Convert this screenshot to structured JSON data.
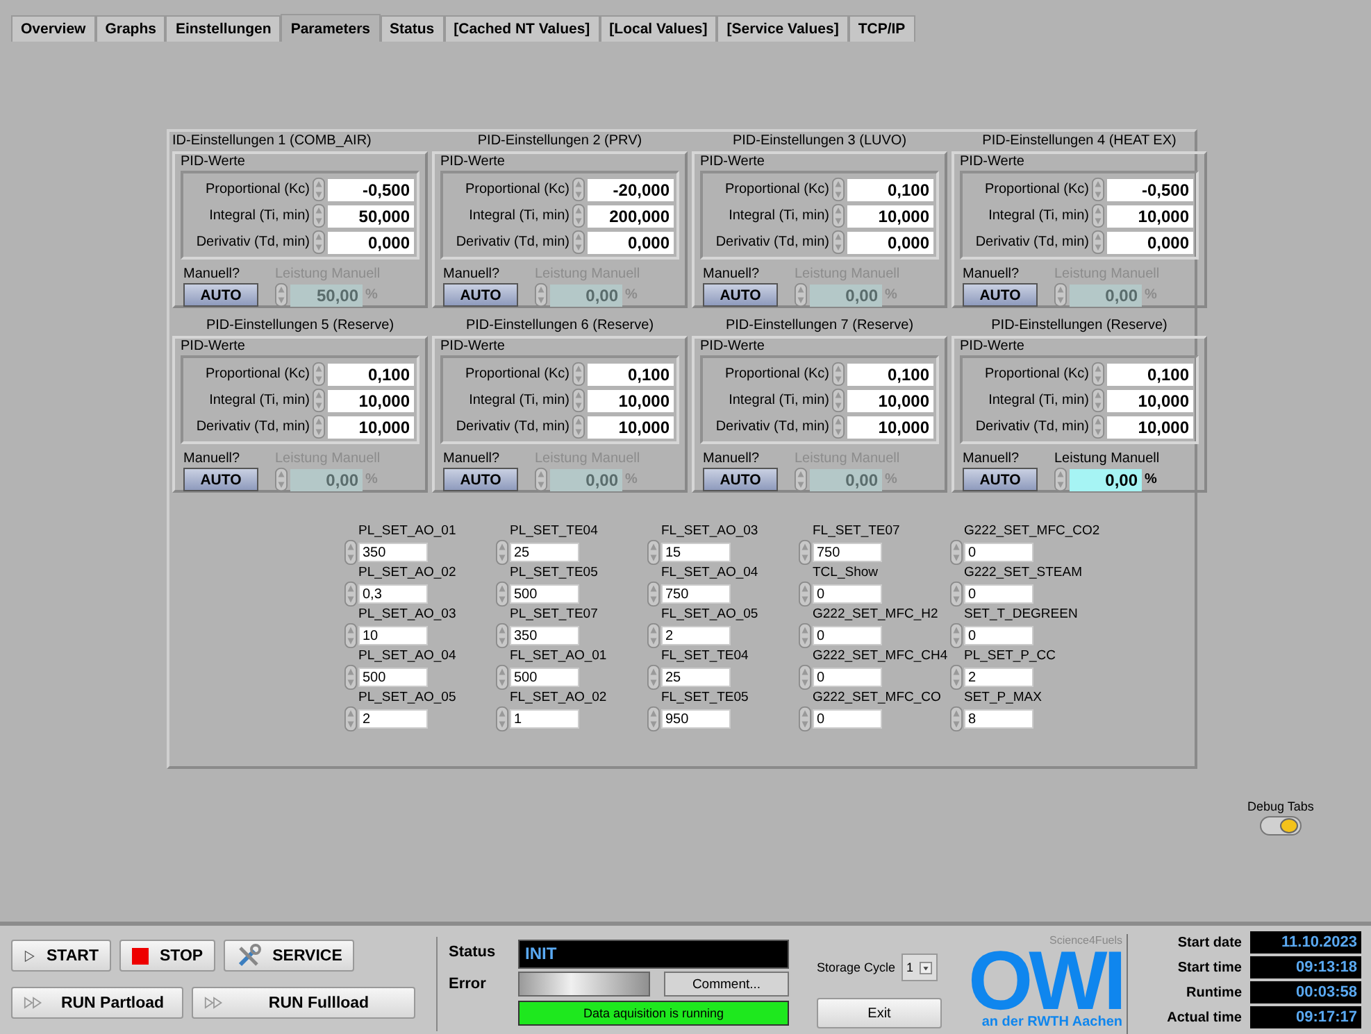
{
  "tabs": [
    {
      "label": "Overview",
      "selected": false
    },
    {
      "label": "Graphs",
      "selected": false
    },
    {
      "label": "Einstellungen",
      "selected": false
    },
    {
      "label": "Parameters",
      "selected": true
    },
    {
      "label": "Status",
      "selected": false
    },
    {
      "label": "[Cached NT Values]",
      "selected": false
    },
    {
      "label": "[Local Values]",
      "selected": false
    },
    {
      "label": "[Service Values]",
      "selected": false
    },
    {
      "label": "TCP/IP",
      "selected": false
    }
  ],
  "pid_panels": [
    {
      "title": "ID-Einstellungen 1 (COMB_AIR)",
      "group_label": "PID-Werte",
      "fields": [
        {
          "label": "Proportional (Kc)",
          "value": "-0,500"
        },
        {
          "label": "Integral (Ti, min)",
          "value": "50,000"
        },
        {
          "label": "Derivativ (Td, min)",
          "value": "0,000"
        }
      ],
      "manual_label": "Manuell?",
      "mode_button": "AUTO",
      "output_label": "Leistung Manuell",
      "output_value": "50,00",
      "output_unit": "%",
      "output_disabled": true
    },
    {
      "title": "PID-Einstellungen 2 (PRV)",
      "group_label": "PID-Werte",
      "fields": [
        {
          "label": "Proportional (Kc)",
          "value": "-20,000"
        },
        {
          "label": "Integral (Ti, min)",
          "value": "200,000"
        },
        {
          "label": "Derivativ (Td, min)",
          "value": "0,000"
        }
      ],
      "manual_label": "Manuell?",
      "mode_button": "AUTO",
      "output_label": "Leistung Manuell",
      "output_value": "0,00",
      "output_unit": "%",
      "output_disabled": true
    },
    {
      "title": "PID-Einstellungen 3 (LUVO)",
      "group_label": "PID-Werte",
      "fields": [
        {
          "label": "Proportional (Kc)",
          "value": "0,100"
        },
        {
          "label": "Integral (Ti, min)",
          "value": "10,000"
        },
        {
          "label": "Derivativ (Td, min)",
          "value": "0,000"
        }
      ],
      "manual_label": "Manuell?",
      "mode_button": "AUTO",
      "output_label": "Leistung Manuell",
      "output_value": "0,00",
      "output_unit": "%",
      "output_disabled": true
    },
    {
      "title": "PID-Einstellungen 4 (HEAT EX)",
      "group_label": "PID-Werte",
      "fields": [
        {
          "label": "Proportional (Kc)",
          "value": "-0,500"
        },
        {
          "label": "Integral (Ti, min)",
          "value": "10,000"
        },
        {
          "label": "Derivativ (Td, min)",
          "value": "0,000"
        }
      ],
      "manual_label": "Manuell?",
      "mode_button": "AUTO",
      "output_label": "Leistung Manuell",
      "output_value": "0,00",
      "output_unit": "%",
      "output_disabled": true
    },
    {
      "title": "PID-Einstellungen 5 (Reserve)",
      "group_label": "PID-Werte",
      "fields": [
        {
          "label": "Proportional (Kc)",
          "value": "0,100"
        },
        {
          "label": "Integral (Ti, min)",
          "value": "10,000"
        },
        {
          "label": "Derivativ (Td, min)",
          "value": "10,000"
        }
      ],
      "manual_label": "Manuell?",
      "mode_button": "AUTO",
      "output_label": "Leistung Manuell",
      "output_value": "0,00",
      "output_unit": "%",
      "output_disabled": true
    },
    {
      "title": "PID-Einstellungen 6 (Reserve)",
      "group_label": "PID-Werte",
      "fields": [
        {
          "label": "Proportional (Kc)",
          "value": "0,100"
        },
        {
          "label": "Integral (Ti, min)",
          "value": "10,000"
        },
        {
          "label": "Derivativ (Td, min)",
          "value": "10,000"
        }
      ],
      "manual_label": "Manuell?",
      "mode_button": "AUTO",
      "output_label": "Leistung Manuell",
      "output_value": "0,00",
      "output_unit": "%",
      "output_disabled": true
    },
    {
      "title": "PID-Einstellungen 7 (Reserve)",
      "group_label": "PID-Werte",
      "fields": [
        {
          "label": "Proportional (Kc)",
          "value": "0,100"
        },
        {
          "label": "Integral (Ti, min)",
          "value": "10,000"
        },
        {
          "label": "Derivativ (Td, min)",
          "value": "10,000"
        }
      ],
      "manual_label": "Manuell?",
      "mode_button": "AUTO",
      "output_label": "Leistung Manuell",
      "output_value": "0,00",
      "output_unit": "%",
      "output_disabled": true
    },
    {
      "title": "PID-Einstellungen (Reserve)",
      "group_label": "PID-Werte",
      "fields": [
        {
          "label": "Proportional (Kc)",
          "value": "0,100"
        },
        {
          "label": "Integral (Ti, min)",
          "value": "10,000"
        },
        {
          "label": "Derivativ (Td, min)",
          "value": "10,000"
        }
      ],
      "manual_label": "Manuell?",
      "mode_button": "AUTO",
      "output_label": "Leistung Manuell",
      "output_value": "0,00",
      "output_unit": "%",
      "output_disabled": false
    }
  ],
  "parameter_columns": [
    [
      {
        "label": "PL_SET_AO_01",
        "value": "350"
      },
      {
        "label": "PL_SET_AO_02",
        "value": "0,3"
      },
      {
        "label": "PL_SET_AO_03",
        "value": "10"
      },
      {
        "label": "PL_SET_AO_04",
        "value": "500"
      },
      {
        "label": "PL_SET_AO_05",
        "value": "2"
      }
    ],
    [
      {
        "label": "PL_SET_TE04",
        "value": "25"
      },
      {
        "label": "PL_SET_TE05",
        "value": "500"
      },
      {
        "label": "PL_SET_TE07",
        "value": "350"
      },
      {
        "label": "FL_SET_AO_01",
        "value": "500"
      },
      {
        "label": "FL_SET_AO_02",
        "value": "1"
      }
    ],
    [
      {
        "label": "FL_SET_AO_03",
        "value": "15"
      },
      {
        "label": "FL_SET_AO_04",
        "value": "750"
      },
      {
        "label": "FL_SET_AO_05",
        "value": "2"
      },
      {
        "label": "FL_SET_TE04",
        "value": "25"
      },
      {
        "label": "FL_SET_TE05",
        "value": "950"
      }
    ],
    [
      {
        "label": "FL_SET_TE07",
        "value": "750"
      },
      {
        "label": "TCL_Show",
        "value": "0"
      },
      {
        "label": "G222_SET_MFC_H2",
        "value": "0"
      },
      {
        "label": "G222_SET_MFC_CH4",
        "value": "0"
      },
      {
        "label": "G222_SET_MFC_CO",
        "value": "0"
      }
    ],
    [
      {
        "label": "G222_SET_MFC_CO2",
        "value": "0"
      },
      {
        "label": "G222_SET_STEAM",
        "value": "0"
      },
      {
        "label": "SET_T_DEGREEN",
        "value": "0"
      },
      {
        "label": "PL_SET_P_CC",
        "value": "2"
      },
      {
        "label": "SET_P_MAX",
        "value": "8"
      }
    ]
  ],
  "debug_toggle": {
    "label": "Debug Tabs",
    "on": true
  },
  "control_buttons": [
    {
      "kind": "start",
      "label": "START"
    },
    {
      "kind": "stop",
      "label": "STOP"
    },
    {
      "kind": "service",
      "label": "SERVICE"
    }
  ],
  "run_buttons": [
    {
      "label": "RUN Partload"
    },
    {
      "label": "RUN Fullload"
    }
  ],
  "status": {
    "label": "Status",
    "value": "INIT"
  },
  "error": {
    "label": "Error",
    "comment_button": "Comment...",
    "acquisition": "Data aquisition is running"
  },
  "storage_cycle": {
    "label": "Storage Cycle",
    "value": "1"
  },
  "exit_button": "Exit",
  "logo": {
    "tagline": "Science4Fuels",
    "letters": "OWI",
    "footer": "an der RWTH Aachen"
  },
  "times": [
    {
      "label": "Start date",
      "value": "11.10.2023"
    },
    {
      "label": "Start time",
      "value": "09:13:18"
    },
    {
      "label": "Runtime",
      "value": "00:03:58"
    },
    {
      "label": "Actual time",
      "value": "09:17:17"
    }
  ]
}
